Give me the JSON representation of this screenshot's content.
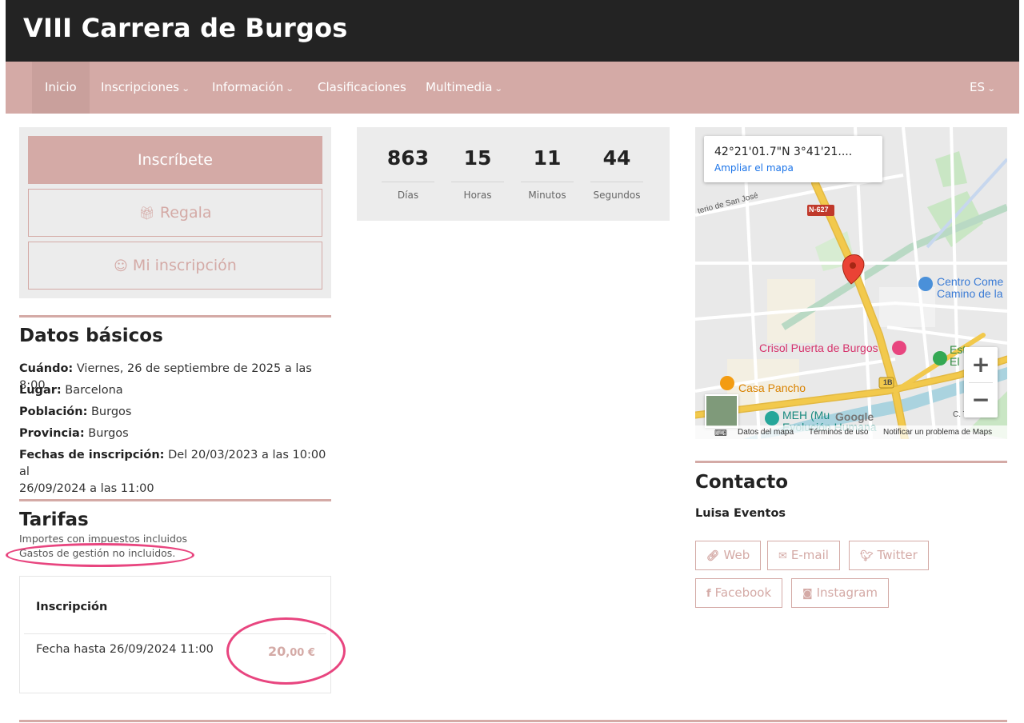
{
  "header": {
    "title": "VIII Carrera de Burgos"
  },
  "nav": {
    "items": [
      {
        "label": "Inicio"
      },
      {
        "label": "Inscripciones"
      },
      {
        "label": "Información"
      },
      {
        "label": "Clasificaciones"
      },
      {
        "label": "Multimedia"
      }
    ],
    "language": "ES",
    "active": "Inicio"
  },
  "actions": {
    "register": "Inscríbete",
    "gift": "Regala",
    "my_registration": "Mi inscripción"
  },
  "countdown": {
    "days": {
      "value": "863",
      "label": "Días"
    },
    "hours": {
      "value": "15",
      "label": "Horas"
    },
    "minutes": {
      "value": "11",
      "label": "Minutos"
    },
    "seconds": {
      "value": "44",
      "label": "Segundos"
    }
  },
  "basic_data": {
    "title": "Datos básicos",
    "when_label": "Cuándo:",
    "when_value": "Viernes, 26 de septiembre de 2025 a las 8:00",
    "place_label": "Lugar:",
    "place_value": "Barcelona",
    "town_label": "Población:",
    "town_value": "Burgos",
    "province_label": "Provincia:",
    "province_value": "Burgos",
    "dates_label": "Fechas de inscripción:",
    "dates_value_1": "Del 20/03/2023 a las 10:00 al",
    "dates_value_2": "26/09/2024 a las 11:00"
  },
  "rates": {
    "title": "Tarifas",
    "note_taxes": "Importes con impuestos incluidos",
    "note_fees": "Gastos de gestión no incluidos.",
    "header": "Inscripción",
    "row_label": "Fecha hasta 26/09/2024 11:00",
    "price_int": "20",
    "price_dec": ",00 €"
  },
  "map": {
    "coords": "42°21'01.7\"N 3°41'21....",
    "expand_link": "Ampliar el mapa",
    "zoom_in": "+",
    "zoom_out": "−",
    "footer_data": "Datos del mapa",
    "footer_terms": "Términos de uso",
    "footer_report": "Notificar un problema de Maps",
    "labels": {
      "road": "N-627",
      "street": "terio de San José",
      "poi_1a": "Centro Come",
      "poi_1b": "Camino de la",
      "poi_2": "Crisol Puerta de Burgos",
      "poi_3": "Casa Pancho",
      "poi_4a": "MEH (Mu",
      "poi_4b": "Evolución Humana",
      "poi_5a": "Esta",
      "poi_5b": "El",
      "exit": "1B",
      "google": "Google",
      "corner": "C. T"
    },
    "colors": {
      "road": "#f2c94c",
      "park": "#c9e6c4",
      "water": "#aad3df",
      "pin": "#ea4335"
    }
  },
  "contact": {
    "title": "Contacto",
    "organizer": "Luisa Eventos",
    "links": [
      {
        "label": "Web",
        "icon": "link-icon"
      },
      {
        "label": "E-mail",
        "icon": "envelope-icon"
      },
      {
        "label": "Twitter",
        "icon": "twitter-icon"
      },
      {
        "label": "Facebook",
        "icon": "facebook-icon"
      },
      {
        "label": "Instagram",
        "icon": "instagram-icon"
      }
    ]
  },
  "colors": {
    "accent": "#d4aaa6",
    "header_bg": "#232323",
    "highlight": "#e8457f"
  }
}
